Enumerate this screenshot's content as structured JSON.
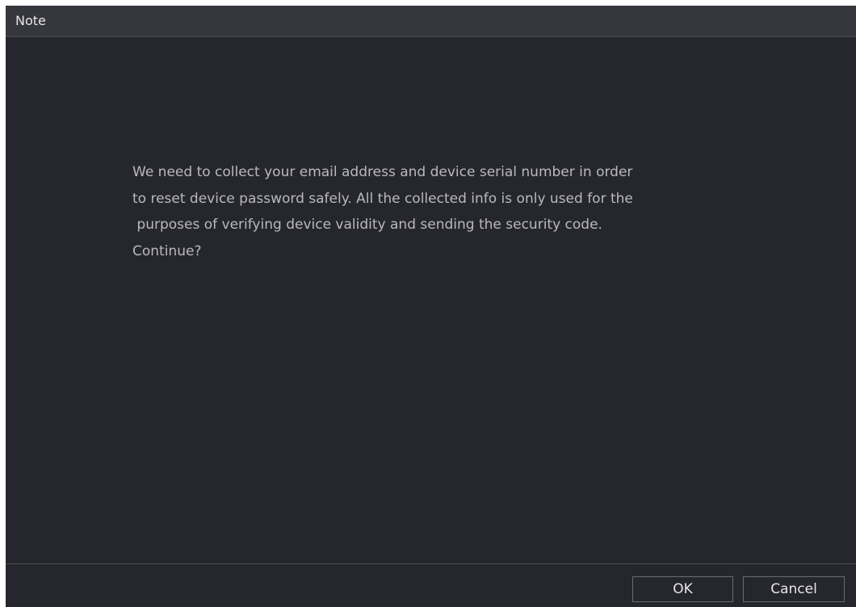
{
  "dialog": {
    "title": "Note",
    "message_lines": [
      "We need to collect your email address and device serial number in order",
      "to reset device password safely. All the collected info is only used for the",
      " purposes of verifying device validity and sending the security code.",
      "Continue?"
    ],
    "ok_label": "OK",
    "cancel_label": "Cancel"
  }
}
